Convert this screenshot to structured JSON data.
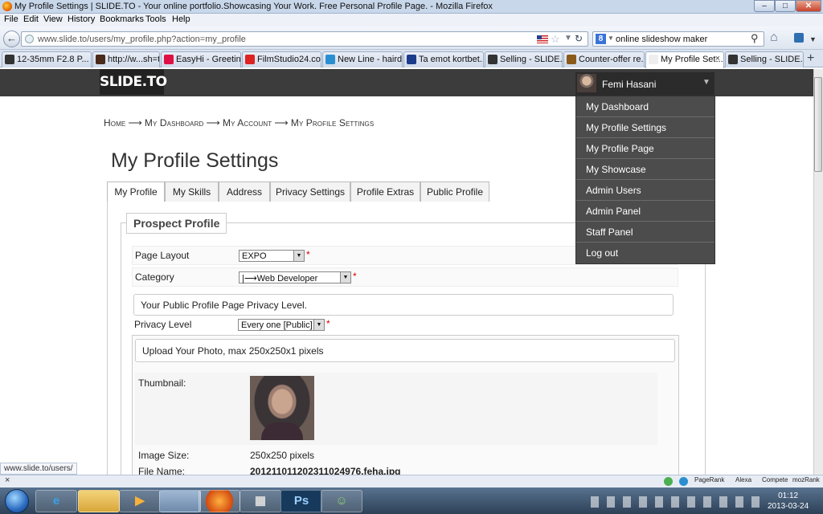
{
  "window": {
    "title": "My Profile Settings | SLIDE.TO - Your online portfolio.Showcasing Your Work. Free Personal Profile Page. - Mozilla Firefox"
  },
  "menu": [
    "File",
    "Edit",
    "View",
    "History",
    "Bookmarks",
    "Tools",
    "Help"
  ],
  "nav": {
    "url": "www.slide.to/users/my_profile.php?action=my_profile",
    "search": "online slideshow maker"
  },
  "tabs": [
    {
      "label": "12-35mm F2.8 P...",
      "color": "#333"
    },
    {
      "label": "http://w...sh=true",
      "color": "#4a2a1a"
    },
    {
      "label": "EasyHi - Greetin...",
      "color": "#d14"
    },
    {
      "label": "FilmStudio24.co...",
      "color": "#d22"
    },
    {
      "label": "New Line - haird...",
      "color": "#2a8fd0"
    },
    {
      "label": "Ta emot kortbet...",
      "color": "#1b3c8a"
    },
    {
      "label": "Selling - SLIDE.T...",
      "color": "#333"
    },
    {
      "label": "Counter-offer re...",
      "color": "#8a5a1a"
    },
    {
      "label": "My Profile Set...",
      "color": "#eee"
    },
    {
      "label": "Selling - SLIDE.T...",
      "color": "#333"
    }
  ],
  "site": {
    "logo": "SLIDE.TO",
    "user": "Femi Hasani"
  },
  "dropdown": [
    "My Dashboard",
    "My Profile Settings",
    "My Profile Page",
    "My Showcase",
    "Admin Users",
    "Admin Panel",
    "Staff Panel",
    "Log out"
  ],
  "breadcrumb": {
    "home": "Home",
    "dashboard": "My Dashboard",
    "account": "My Account",
    "settings": "My Profile Settings",
    "arrow": "⟶"
  },
  "page_title": "My Profile Settings",
  "page_tabs": [
    "My Profile",
    "My Skills",
    "Address",
    "Privacy Settings",
    "Profile Extras",
    "Public Profile"
  ],
  "form": {
    "legend": "Prospect Profile",
    "layout_label": "Page Layout",
    "layout_value": "EXPO",
    "category_label": "Category",
    "category_value": "|⟶Web Developer",
    "privacy_note": "Your Public Profile Page Privacy Level.",
    "privacy_label": "Privacy Level",
    "privacy_value": "Every one [Public]",
    "upload_note": "Upload Your Photo, max 250x250x1 pixels",
    "thumb_label": "Thumbnail:",
    "size_label": "Image Size:",
    "size_value": "250x250 pixels",
    "file_label": "File Name:",
    "file_value": "20121101120231102⁠4976.feha.jpg",
    "required": "*"
  },
  "status": {
    "url": "www.slide.to/users/",
    "pagerank": "PageRank",
    "alexa": "Alexa",
    "compete": "Compete",
    "mozrank": "mozRank"
  },
  "clock": {
    "time": "01:12",
    "date": "2013-03-24"
  }
}
